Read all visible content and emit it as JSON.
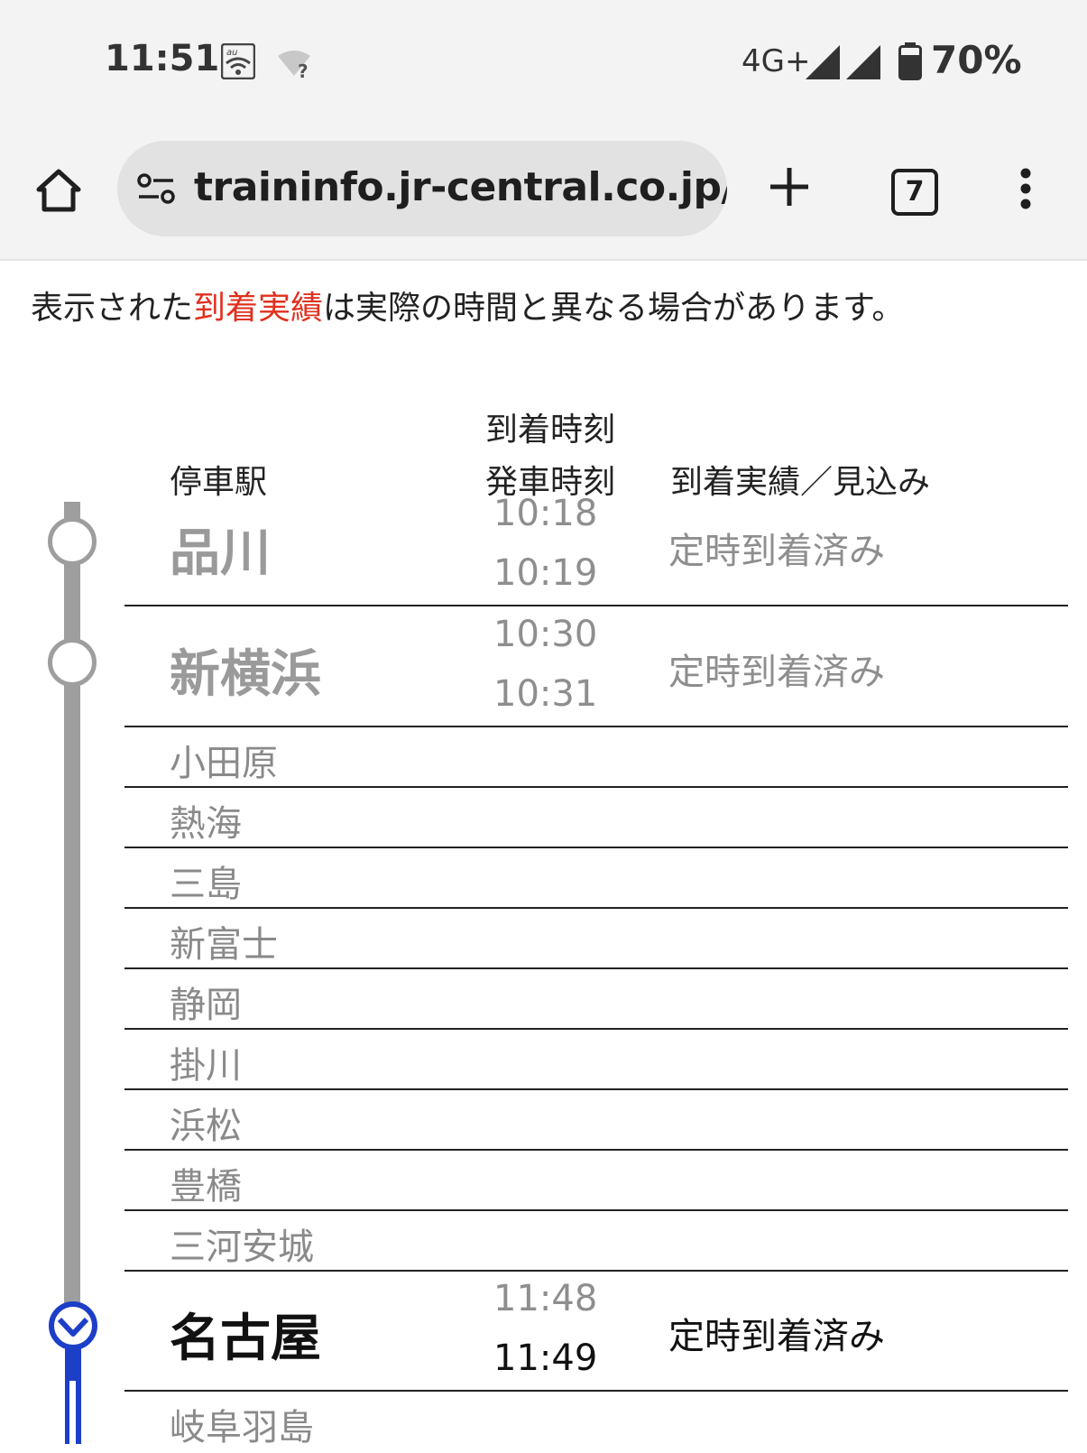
{
  "status_bar": {
    "time": "11:51",
    "carrier_icon": "au-wifi-icon",
    "wifi_icon": "wifi-unknown-icon",
    "network": "4G+",
    "battery": "70%"
  },
  "browser": {
    "url": "traininfo.jr-central.co.jp/sh",
    "tab_count": "7"
  },
  "notice": {
    "before": "表示された",
    "highlight": "到着実績",
    "after": "は実際の時間と異なる場合があります。",
    "highlight_color": "#e0301e"
  },
  "table": {
    "headers": {
      "station": "停車駅",
      "arrival_time": "到着時刻",
      "departure_time": "発車時刻",
      "result": "到着実績／見込み"
    },
    "stops": [
      {
        "name": "品川",
        "arrive": "10:18",
        "depart": "10:19",
        "result": "定時到着済み"
      },
      {
        "name": "新横浜",
        "arrive": "10:30",
        "depart": "10:31",
        "result": "定時到着済み"
      },
      {
        "name": "小田原"
      },
      {
        "name": "熱海"
      },
      {
        "name": "三島"
      },
      {
        "name": "新富士"
      },
      {
        "name": "静岡"
      },
      {
        "name": "掛川"
      },
      {
        "name": "浜松"
      },
      {
        "name": "豊橋"
      },
      {
        "name": "三河安城"
      },
      {
        "name": "名古屋",
        "arrive": "11:48",
        "depart": "11:49",
        "result": "定時到着済み"
      },
      {
        "name": "岐阜羽島"
      }
    ]
  },
  "colors": {
    "passed_line": "#9e9e9e",
    "current_line": "#1d3fc8"
  }
}
